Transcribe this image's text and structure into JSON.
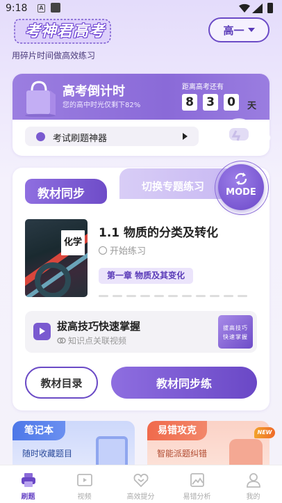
{
  "status_bar": {
    "time": "9:18",
    "a_badge": "A"
  },
  "brand": {
    "logo_text": "考神君高考",
    "slogan": "用碎片时间做高效练习"
  },
  "grade_selector": {
    "value": "高一"
  },
  "countdown": {
    "title": "高考倒计时",
    "subtitle": "您的高中时光仅剩下82%",
    "label": "距离高考还有",
    "digits": [
      "8",
      "3",
      "0"
    ],
    "unit": "天",
    "tool_label": "考试刷题神器"
  },
  "sync": {
    "tab_active": "教材同步",
    "tab_other": "切换专题练习",
    "mode_label": "MODE",
    "book_cover": "化学",
    "lesson_title": "1.1 物质的分类及转化",
    "start_label": "开始练习",
    "chapter": "第一章 物质及其变化",
    "skill_title": "拔高技巧快速掌握",
    "skill_sub": "知识点关联视频",
    "skill_thumb": [
      "拔高技巧",
      "快速掌握"
    ],
    "btn_catalog": "教材目录",
    "btn_practice": "教材同步练"
  },
  "feature_cards": [
    {
      "tag": "笔记本",
      "sub": "随时收藏题目"
    },
    {
      "tag": "易错攻克",
      "sub": "智能派题纠错",
      "badge": "NEW"
    }
  ],
  "tabbar": [
    {
      "label": "刷题",
      "icon": "printer-icon",
      "active": true
    },
    {
      "label": "视频",
      "icon": "video-icon",
      "active": false
    },
    {
      "label": "高效提分",
      "icon": "heart-chevron-icon",
      "active": false
    },
    {
      "label": "易错分析",
      "icon": "image-analysis-icon",
      "active": false
    },
    {
      "label": "我的",
      "icon": "person-icon",
      "active": false
    }
  ],
  "colors": {
    "accent": "#6b4bc6",
    "note": "#4e78e8",
    "error": "#f06a4c"
  }
}
